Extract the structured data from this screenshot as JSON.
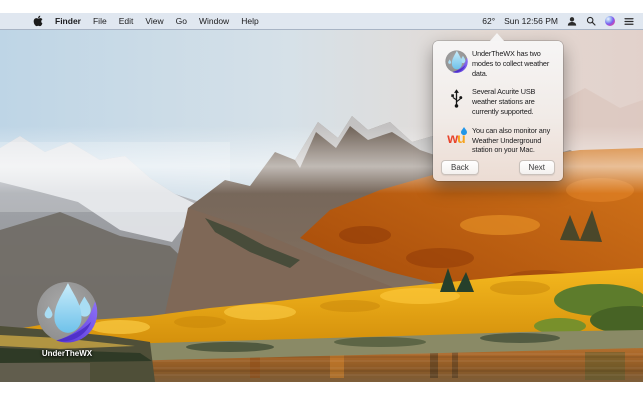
{
  "menu_bar": {
    "items": [
      "Finder",
      "File",
      "Edit",
      "View",
      "Go",
      "Window",
      "Help"
    ],
    "temperature": "62°",
    "clock": "Sun 12:56 PM",
    "status_icons": [
      "user-icon",
      "spotlight-search-icon",
      "siri-icon",
      "notification-center-icon"
    ]
  },
  "popover": {
    "steps": [
      {
        "icon": "underthewx-app-icon",
        "lines": [
          "UnderTheWX has two",
          "modes to collect weather",
          "data."
        ]
      },
      {
        "icon": "usb-icon",
        "lines": [
          "Several Acurite USB",
          "weather stations are",
          "currently supported."
        ]
      },
      {
        "icon": "weather-underground-logo",
        "lines": [
          "You can also monitor any",
          "Weather Underground",
          "station on your Mac."
        ]
      }
    ],
    "wu_logo": {
      "w": "w",
      "u": "u"
    },
    "back_button": "Back",
    "next_button": "Next"
  },
  "desktop": {
    "app_icon_label": "UnderTheWX"
  },
  "colors": {
    "menu_bar_bg": "#e0e7f0",
    "popover_bg_top": "#f6f5f5",
    "popover_bg_bottom": "#ecdcd3",
    "app_icon_gray": "#9b9b9b",
    "app_icon_purple": "#6a4fe0",
    "app_icon_drop_blue": "#8fd4f2",
    "wu_w": "#e8442c",
    "wu_u": "#f6a41f",
    "foliage_orange": "#c25a10",
    "tree_gold": "#eeab12"
  }
}
